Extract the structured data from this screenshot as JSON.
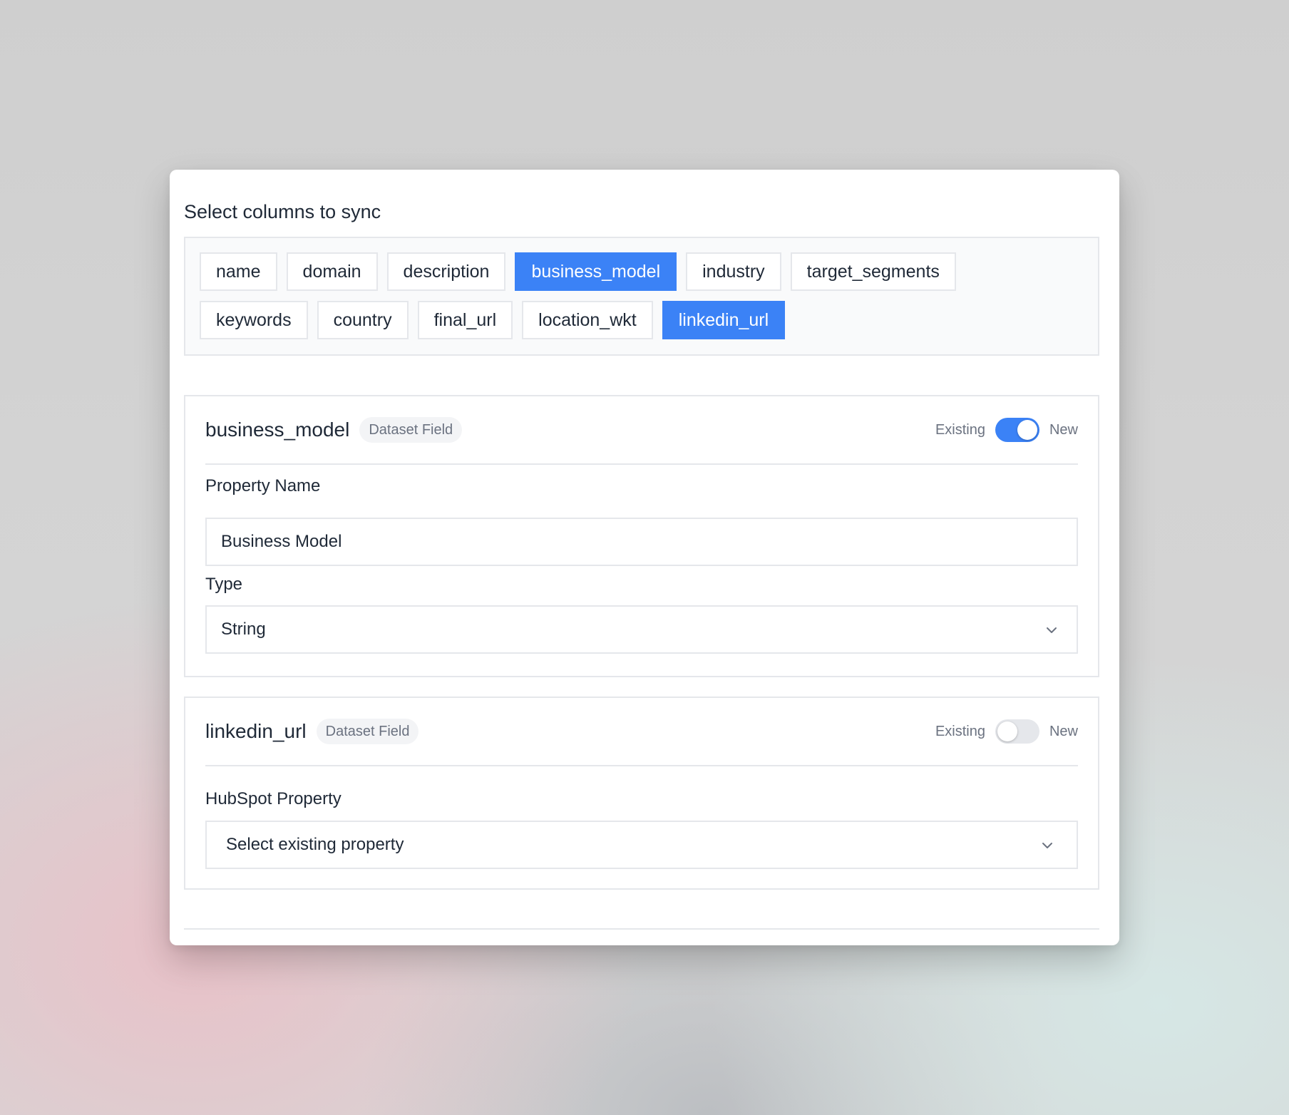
{
  "title": "Select columns to sync",
  "chips_row1": [
    {
      "label": "name",
      "selected": false
    },
    {
      "label": "domain",
      "selected": false
    },
    {
      "label": "description",
      "selected": false
    },
    {
      "label": "business_model",
      "selected": true
    },
    {
      "label": "industry",
      "selected": false
    },
    {
      "label": "target_segments",
      "selected": false
    }
  ],
  "chips_row2": [
    {
      "label": "keywords",
      "selected": false
    },
    {
      "label": "country",
      "selected": false
    },
    {
      "label": "final_url",
      "selected": false
    },
    {
      "label": "location_wkt",
      "selected": false
    },
    {
      "label": "linkedin_url",
      "selected": true
    }
  ],
  "colors": {
    "accent": "#3b82f6",
    "border": "#e5e7eb",
    "muted": "#6b7280"
  },
  "fields": [
    {
      "name": "business_model",
      "badge": "Dataset Field",
      "toggle_left": "Existing",
      "toggle_right": "New",
      "toggle_on": true,
      "property_label": "Property Name",
      "property_value": "Business Model",
      "type_label": "Type",
      "type_value": "String"
    },
    {
      "name": "linkedin_url",
      "badge": "Dataset Field",
      "toggle_left": "Existing",
      "toggle_right": "New",
      "toggle_on": false,
      "hubspot_label": "HubSpot Property",
      "hubspot_value": "Select existing property"
    }
  ],
  "icons": {
    "dropdown": "chevron-down-icon"
  }
}
